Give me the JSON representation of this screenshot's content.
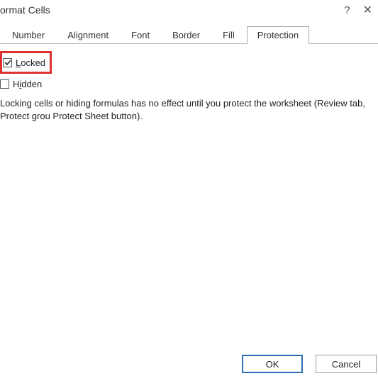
{
  "title": "ormat Cells",
  "tabs": [
    {
      "label": "Number",
      "active": false
    },
    {
      "label": "Alignment",
      "active": false
    },
    {
      "label": "Font",
      "active": false
    },
    {
      "label": "Border",
      "active": false
    },
    {
      "label": "Fill",
      "active": false
    },
    {
      "label": "Protection",
      "active": true
    }
  ],
  "options": {
    "locked": {
      "label": "Locked",
      "checked": true
    },
    "hidden": {
      "label": "Hidden",
      "checked": false
    }
  },
  "help_text": "Locking cells or hiding formulas has no effect until you protect the worksheet (Review tab, Protect grou Protect Sheet button).",
  "buttons": {
    "ok": "OK",
    "cancel": "Cancel"
  },
  "icons": {
    "help": "?",
    "close": "✕"
  }
}
